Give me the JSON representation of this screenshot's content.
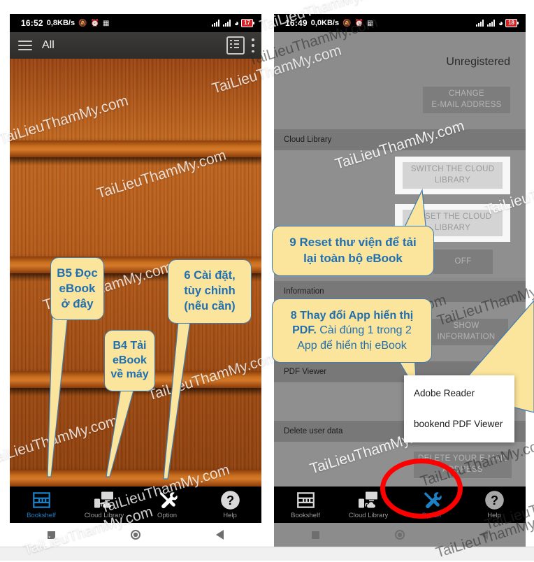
{
  "page": {
    "watermark_text": "TaiLieuThamMy.com"
  },
  "left_phone": {
    "status_bar": {
      "time": "16:52",
      "network_speed": "0,8KB/s",
      "mute_icon": "bell-muted-icon",
      "alarm_icon": "alarm-clock-icon",
      "app_icon": "app-badge-icon",
      "signal_icon_1": "signal-bars-icon",
      "signal_icon_2": "signal-bars-icon",
      "wifi_icon": "wifi-icon",
      "battery": "17"
    },
    "app_bar": {
      "menu_icon": "hamburger-menu-icon",
      "title": "All",
      "list_icon": "list-view-icon",
      "overflow_icon": "overflow-menu-icon"
    },
    "bottom_nav": [
      {
        "label": "Bookshelf",
        "icon": "bookshelf-icon",
        "active": true
      },
      {
        "label": "Cloud Library",
        "icon": "cloud-library-icon",
        "active": false
      },
      {
        "label": "Option",
        "icon": "tools-option-icon",
        "active": false
      },
      {
        "label": "Help",
        "icon": "question-help-icon",
        "active": false
      }
    ],
    "system_nav": {
      "recents_icon": "recents-square-icon",
      "home_icon": "home-circle-icon",
      "back_icon": "back-triangle-icon"
    },
    "callouts": [
      {
        "id": "b5",
        "lines": [
          "B5 Đọc",
          "eBook",
          "ở đây"
        ]
      },
      {
        "id": "b4",
        "lines": [
          "B4 Tải",
          "eBook",
          "về máy"
        ]
      },
      {
        "id": "c6",
        "lines": [
          "6 Cài đặt,",
          "tùy chỉnh",
          "(nếu cần)"
        ]
      }
    ]
  },
  "right_phone": {
    "status_bar": {
      "time": "16:49",
      "network_speed": "0,0KB/s",
      "mute_icon": "bell-muted-icon",
      "alarm_icon": "alarm-clock-icon",
      "app_icon": "app-badge-icon",
      "signal_icon_1": "signal-bars-icon",
      "signal_icon_2": "signal-bars-icon",
      "wifi_icon": "wifi-icon",
      "battery": "18"
    },
    "account": {
      "status": "Unregistered",
      "change_email_button": "CHANGE\nE-MAIL ADDRESS",
      "change_email_line1": "CHANGE",
      "change_email_line2": "E-MAIL ADDRESS"
    },
    "sections": [
      {
        "title": "Cloud Library"
      },
      {
        "title": "Information"
      },
      {
        "title": "PDF Viewer"
      },
      {
        "title": "Delete user data"
      }
    ],
    "buttons": {
      "switch_cloud_line1": "SWITCH THE CLOUD",
      "switch_cloud_line2": "LIBRARY",
      "reset_cloud_line1": "RESET THE CLOUD",
      "reset_cloud_line2": "LIBRARY",
      "off_toggle": "OFF",
      "show_info_line1": "SHOW",
      "show_info_line2": "INFORMATION",
      "delete_email_line1": "DELETE YOUR E-MAIL",
      "delete_email_line2": "ADDRESS"
    },
    "pdf_viewer_dropdown": {
      "options": [
        "Adobe Reader",
        "bookend PDF Viewer"
      ]
    },
    "bottom_nav": [
      {
        "label": "Bookshelf",
        "icon": "bookshelf-icon",
        "active": false
      },
      {
        "label": "Cloud Library",
        "icon": "cloud-library-icon",
        "active": false
      },
      {
        "label": "Option",
        "icon": "tools-option-icon",
        "active": true
      },
      {
        "label": "Help",
        "icon": "question-help-icon",
        "active": false
      }
    ],
    "system_nav": {
      "recents_icon": "recents-square-icon",
      "home_icon": "home-circle-icon",
      "back_icon": "back-triangle-icon"
    },
    "callouts": [
      {
        "id": "c9",
        "lines": [
          "9 Reset thư viện để tải",
          "lại toàn bộ eBook"
        ]
      },
      {
        "id": "c8_bold",
        "text": "8 Thay đổi App hiển thị"
      },
      {
        "id": "c8_bold2",
        "text": "PDF."
      },
      {
        "id": "c8_norm2",
        "text": "Cài đúng 1 trong 2"
      },
      {
        "id": "c8_norm3",
        "text": "App để hiển thị eBook"
      }
    ],
    "highlight": {
      "ring_color": "#ff0000",
      "target": "Option"
    }
  },
  "colors": {
    "callout_fill": "#fbe49b",
    "callout_border": "#3f7cb5",
    "callout_text": "#1f6fb2",
    "accent_blue": "#1d7fc4",
    "highlight_red": "#ff0000"
  }
}
